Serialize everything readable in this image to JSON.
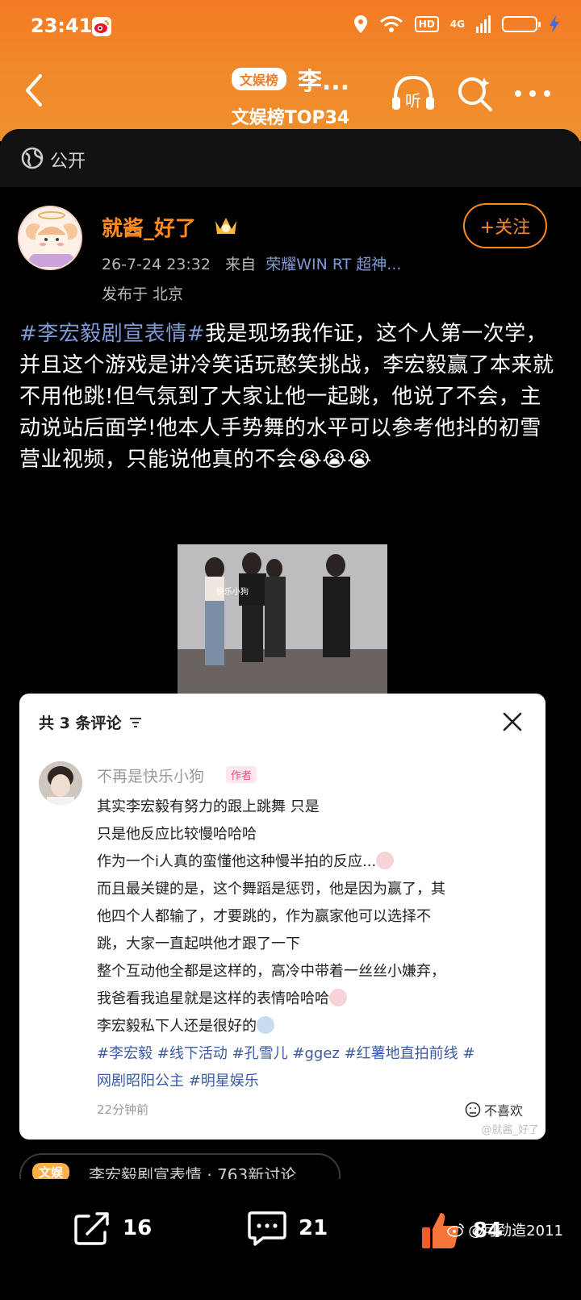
{
  "status_bar": {
    "time": "23:41",
    "hd": "HD",
    "signal": "4G"
  },
  "header": {
    "category_pill": "文娱榜",
    "title": "李...",
    "subtitle": "文娱榜TOP34",
    "listen_label": "听",
    "accent": "#f47a25"
  },
  "visibility": {
    "label": "公开"
  },
  "post": {
    "username": "就酱_好了",
    "date": "26-7-24 23:32",
    "from_prefix": "来自",
    "device": "荣耀WIN RT 超神...",
    "location": "发布于 北京",
    "follow_label": "+关注",
    "hashtag": "#李宏毅剧宣表情#",
    "text": "我是现场我作证，这个人第一次学，并且这个游戏是讲冷笑话玩憨笑挑战，李宏毅赢了本来就不用他跳!但气氛到了大家让他一起跳，他说了不会，主动说站后面学!他本人手势舞的水平可以参考他抖的初雪营业视频，只能说他真的不会",
    "emoji_tail": "😭😭😭",
    "video_caption": "快乐小狗"
  },
  "comment_card": {
    "header": "共 3 条评论",
    "commenter": "不再是快乐小狗",
    "author_badge": "作者",
    "lines": [
      "其实李宏毅有努力的跟上跳舞 只是",
      "只是他反应比较慢哈哈哈",
      "作为一个i人真的蛮懂他这种慢半拍的反应...",
      "而且最关键的是，这个舞蹈是惩罚，他是因为赢了，其",
      "他四个人都输了，才要跳的，作为赢家他可以选择不",
      "跳，大家一直起哄他才跟了一下",
      "整个互动他全都是这样的，高冷中带着一丝丝小嫌弃，",
      "我爸看我追星就是这样的表情哈哈哈",
      "李宏毅私下人还是很好的"
    ],
    "tags_line1": "#李宏毅 #线下活动 #孔雪儿 #ggez #红薯地直拍前线 #",
    "tags_line2": "网剧昭阳公主 #明星娱乐",
    "time": "22分钟前",
    "dislike": "不喜欢",
    "watermark": "@就酱_好了"
  },
  "topic": {
    "pill": "文娱",
    "text": "李宏毅剧宣表情 · 763新讨论"
  },
  "actions": {
    "share_count": "16",
    "comment_count": "21",
    "like_count": "84"
  },
  "watermark": "@可劲造2011"
}
